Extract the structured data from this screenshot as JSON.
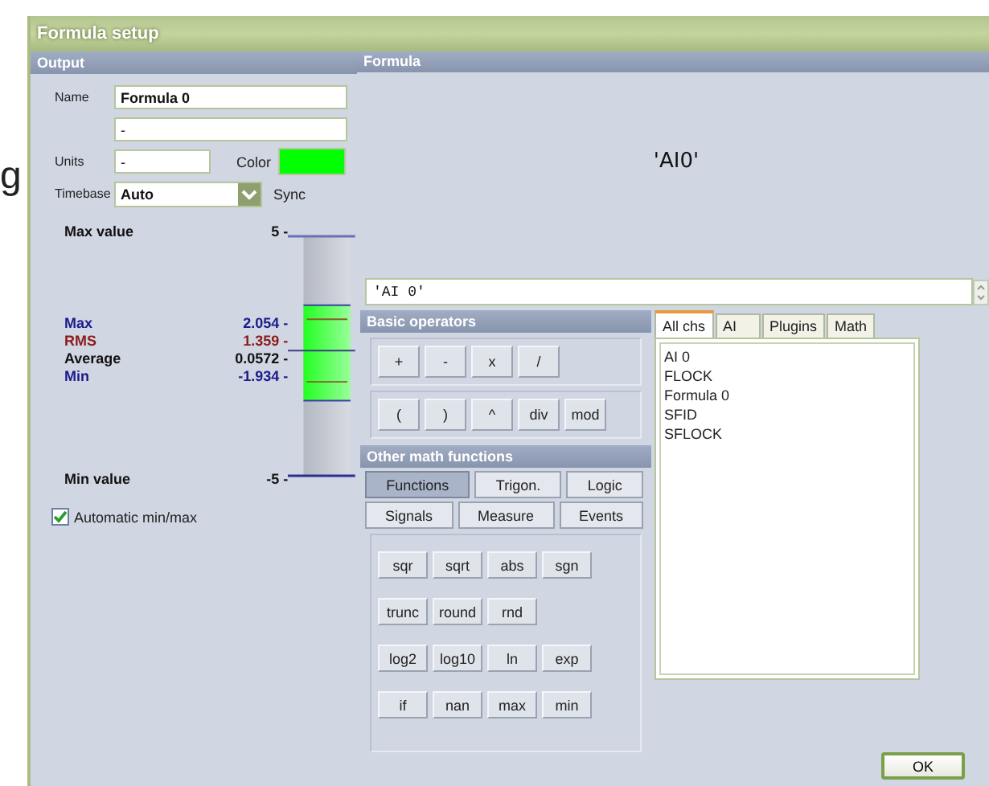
{
  "background_text": "g",
  "window": {
    "title": "Formula setup"
  },
  "output": {
    "header": "Output",
    "name_label": "Name",
    "name_value": "Formula 0",
    "description_value": "-",
    "units_label": "Units",
    "units_value": "-",
    "color_label": "Color",
    "color": "#00ff00",
    "timebase_label": "Timebase",
    "timebase_value": "Auto",
    "sync_label": "Sync",
    "max_label": "Max value",
    "max_value": "5 -",
    "stats": [
      {
        "label": "Max",
        "value": "2.054 -",
        "color": "#1a1a8c"
      },
      {
        "label": "RMS",
        "value": "1.359 -",
        "color": "#8c1a1a"
      },
      {
        "label": "Average",
        "value": "0.0572 -",
        "color": "#111111"
      },
      {
        "label": "Min",
        "value": "-1.934 -",
        "color": "#1a1a8c"
      }
    ],
    "min_label": "Min value",
    "min_value": "-5 -",
    "auto_minmax": {
      "label": "Automatic min/max",
      "checked": true
    }
  },
  "formula": {
    "header": "Formula",
    "preview": "'AI0'",
    "expression": "'AI 0'",
    "basic_header": "Basic operators",
    "operator_rows": [
      [
        "+",
        "-",
        "x",
        "/"
      ],
      [
        "(",
        ")",
        "^",
        "div",
        "mod"
      ]
    ],
    "functions_header": "Other math functions",
    "categories": [
      [
        {
          "label": "Functions",
          "selected": true
        },
        {
          "label": "Trigon.",
          "selected": false
        },
        {
          "label": "Logic",
          "selected": false
        }
      ],
      [
        {
          "label": "Signals",
          "selected": false
        },
        {
          "label": "Measure",
          "selected": false
        },
        {
          "label": "Events",
          "selected": false
        }
      ]
    ],
    "function_rows": [
      [
        "sqr",
        "sqrt",
        "abs",
        "sgn"
      ],
      [
        "trunc",
        "round",
        "rnd"
      ],
      [
        "log2",
        "log10",
        "ln",
        "exp"
      ],
      [
        "if",
        "nan",
        "max",
        "min"
      ]
    ],
    "channel_tabs": [
      {
        "label": "All chs",
        "selected": true
      },
      {
        "label": "AI",
        "selected": false
      },
      {
        "label": "Plugins",
        "selected": false
      },
      {
        "label": "Math",
        "selected": false
      }
    ],
    "channels": [
      "AI 0",
      "FLOCK",
      "Formula 0",
      "SFID",
      "SFLOCK"
    ],
    "ok": "OK"
  }
}
